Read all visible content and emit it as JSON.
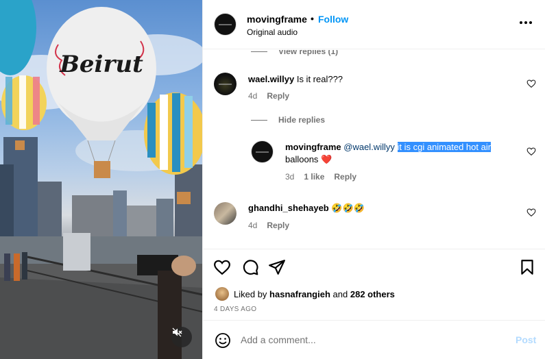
{
  "header": {
    "username": "movingframe",
    "separator": "•",
    "follow_label": "Follow",
    "audio": "Original audio",
    "more_icon": "more-horizontal-icon"
  },
  "comments": {
    "view_replies_partial": "View replies (1)",
    "items": [
      {
        "username": "wael.willyy",
        "text": "Is it real???",
        "age": "4d",
        "reply_label": "Reply"
      },
      {
        "username": "ghandhi_shehayeb",
        "text": "🤣🤣🤣",
        "age": "4d",
        "reply_label": "Reply"
      }
    ],
    "hide_replies": "Hide replies",
    "reply": {
      "username": "movingframe",
      "mention": "@wael.willyy",
      "text_highlighted": "it is cgi animated hot air",
      "text_rest": "balloons",
      "emoji": "❤️",
      "age": "3d",
      "likes": "1 like",
      "reply_label": "Reply"
    }
  },
  "media": {
    "balloon_text": "Beirut"
  },
  "actions": {
    "liked_by_prefix": "Liked by",
    "liked_by_user": "hasnafrangieh",
    "liked_by_and": "and",
    "liked_by_others": "282 others",
    "date": "4 DAYS AGO"
  },
  "add_comment": {
    "placeholder": "Add a comment...",
    "post_label": "Post"
  },
  "colors": {
    "accent": "#0095f6",
    "highlight": "#3390ff",
    "secondary_text": "#737373",
    "heart_red": "#ed4956"
  }
}
